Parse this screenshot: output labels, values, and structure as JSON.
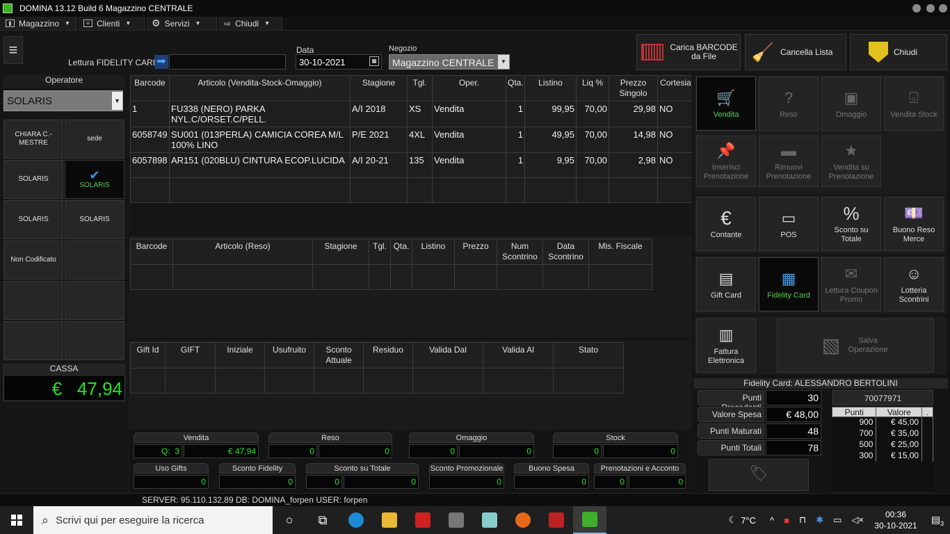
{
  "window": {
    "title": "DOMINA 13.12 Build 6  Magazzino CENTRALE"
  },
  "menu": [
    {
      "label": "Magazzino",
      "icon": "bar-chart-icon"
    },
    {
      "label": "Clienti",
      "icon": "list-icon"
    },
    {
      "label": "Servizi",
      "icon": "gear-icon"
    },
    {
      "label": "Chiudi",
      "icon": "exit-icon"
    }
  ],
  "toolbar": {
    "fidelity_label": "Lettura FIDELITY CARD",
    "fidelity_value": "",
    "date_label": "Data",
    "date_value": "30-10-2021",
    "negozio_label": "Negozio",
    "negozio_value": "Magazzino CENTRALE",
    "carica_label": "Carica BARCODE da File",
    "cancella_label": "Cancella Lista",
    "chiudi_label": "Chiudi"
  },
  "operatore": {
    "header": "Operatore",
    "selected": "SOLARIS",
    "buttons": [
      "CHIARA C.- MESTRE",
      "sede",
      "SOLARIS",
      "SOLARIS",
      "SOLARIS",
      "SOLARIS",
      "Non Codificato",
      "",
      "",
      "",
      "",
      ""
    ],
    "selected_index": 3
  },
  "cassa": {
    "label": "CASSA",
    "currency": "€",
    "value": "47,94"
  },
  "vendita_table": {
    "headers": [
      "Barcode",
      "Articolo (Vendita-Stock-Omaggio)",
      "Stagione",
      "Tgl.",
      "Oper.",
      "Qta.",
      "Listino",
      "Liq %",
      "Prezzo Singolo",
      "Cortesia"
    ],
    "rows": [
      [
        "1",
        "FU338 (NERO) PARKA NYL.C/ORSET.C/PELL.",
        "A/I 2018",
        "XS",
        "Vendita",
        "1",
        "99,95",
        "70,00",
        "29,98",
        "NO"
      ],
      [
        "6058749",
        "SU001 (013PERLA) CAMICIA COREA M/L 100% LINO",
        "P/E 2021",
        "4XL",
        "Vendita",
        "1",
        "49,95",
        "70,00",
        "14,98",
        "NO"
      ],
      [
        "6057898",
        "AR151 (020BLU) CINTURA ECOP.LUCIDA",
        "A/I 20-21",
        "135",
        "Vendita",
        "1",
        "9,95",
        "70,00",
        "2,98",
        "NO"
      ]
    ]
  },
  "reso_table": {
    "headers": [
      "Barcode",
      "Articolo (Reso)",
      "Stagione",
      "Tgl.",
      "Qta.",
      "Listino",
      "Prezzo",
      "Num Scontrino",
      "Data Scontrino",
      "Mis. Fiscale"
    ]
  },
  "gift_table": {
    "headers": [
      "Gift Id",
      "GIFT",
      "Iniziale",
      "Usufruito",
      "Sconto Attuale",
      "Residuo",
      "Valida Dal",
      "Valida Al",
      "Stato"
    ]
  },
  "totals": {
    "vendita_label": "Vendita",
    "vendita_q_label": "Q:",
    "vendita_q": "3",
    "vendita_value": "€  47,94",
    "reso_label": "Reso",
    "reso_q": "0",
    "reso_value": "0",
    "omaggio_label": "Omaggio",
    "omaggio_q": "0",
    "omaggio_value": "0",
    "stock_label": "Stock",
    "stock_q": "0",
    "stock_value": "0",
    "uso_gifts_label": "Uso Gifts",
    "uso_gifts": "0",
    "sconto_fidelity_label": "Sconto Fidelity",
    "sconto_fidelity": "0",
    "sconto_totale_label": "Sconto su Totale",
    "sconto_totale_a": "0",
    "sconto_totale_b": "0",
    "sconto_promo_label": "Sconto Promozionale",
    "sconto_promo": "0",
    "buono_spesa_label": "Buono Spesa",
    "buono_spesa": "0",
    "prenotazioni_label": "Prenotazioni e Acconto",
    "prenotazioni_a": "0",
    "prenotazioni_b": "0"
  },
  "actions": {
    "vendita": "Vendita",
    "reso": "Reso",
    "omaggio": "Omaggio",
    "vendita_stock": "Vendita Stock",
    "inserisci_pren": "Inserisci Prenotazione",
    "rimuovi_pren": "Rimuovi Prenotazione",
    "vendita_pren": "Vendita su Prenotazione",
    "contante": "Contante",
    "pos": "POS",
    "sconto_totale": "Sconto su Totale",
    "buono_reso": "Buono Reso Merce",
    "gift_card": "Gift Card",
    "fidelity_card": "Fidelity Card",
    "coupon": "Lettura Coupon Promo",
    "lotteria": "Lotteria Scontrini",
    "fattura": "Fattura Elettronica",
    "salva": "Salva Operazione"
  },
  "fidelity": {
    "header": "Fidelity Card: ALESSANDRO BERTOLINI",
    "punti_precedenti_label": "Punti Precedenti",
    "punti_precedenti": "30",
    "valore_spesa_label": "Valore Spesa",
    "valore_spesa": "€  48,00",
    "punti_maturati_label": "Punti Maturati",
    "punti_maturati": "48",
    "punti_totali_label": "Punti Totali",
    "punti_totali": "78",
    "card_number": "70077971",
    "table_headers": [
      "Punti",
      "Valore",
      "."
    ],
    "table_rows": [
      [
        "900",
        "€  45,00"
      ],
      [
        "700",
        "€  35,00"
      ],
      [
        "500",
        "€  25,00"
      ],
      [
        "300",
        "€  15,00"
      ]
    ]
  },
  "status": {
    "text": "SERVER: 95.110.132.89 DB: DOMINA_forpen USER: forpen"
  },
  "taskbar": {
    "search_placeholder": "Scrivi qui per eseguire la ricerca",
    "temperature": "7°C",
    "time": "00:36",
    "date": "30-10-2021",
    "notifications": "3"
  }
}
